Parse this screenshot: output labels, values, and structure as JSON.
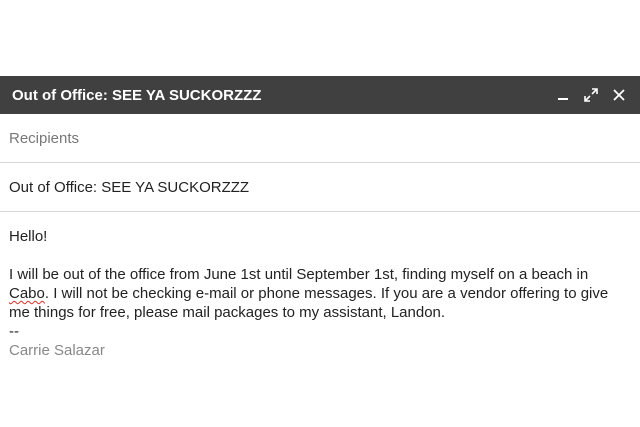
{
  "window": {
    "title": "Out of Office: SEE YA SUCKORZZZ",
    "colors": {
      "titlebar_bg": "#404040",
      "titlebar_text": "#ffffff",
      "signature": "#888888",
      "spellcheck": "#d93025"
    },
    "controls": [
      {
        "icon": "minimize-icon"
      },
      {
        "icon": "expand-icon"
      },
      {
        "icon": "close-icon"
      }
    ]
  },
  "recipients": {
    "placeholder": "Recipients"
  },
  "subject": {
    "value": "Out of Office: SEE YA SUCKORZZZ"
  },
  "message": {
    "greeting": "Hello!",
    "line1": "I will be out of the office from June 1st until September 1st, finding myself on a beach in",
    "misspelled_word": "Cabo",
    "line2_rest": ". I will not be checking e-mail or phone messages. If you are a vendor offering to give",
    "line3": "me things for free, please mail packages to my assistant, Landon.",
    "signature_separator": "--",
    "signature": "Carrie Salazar"
  }
}
